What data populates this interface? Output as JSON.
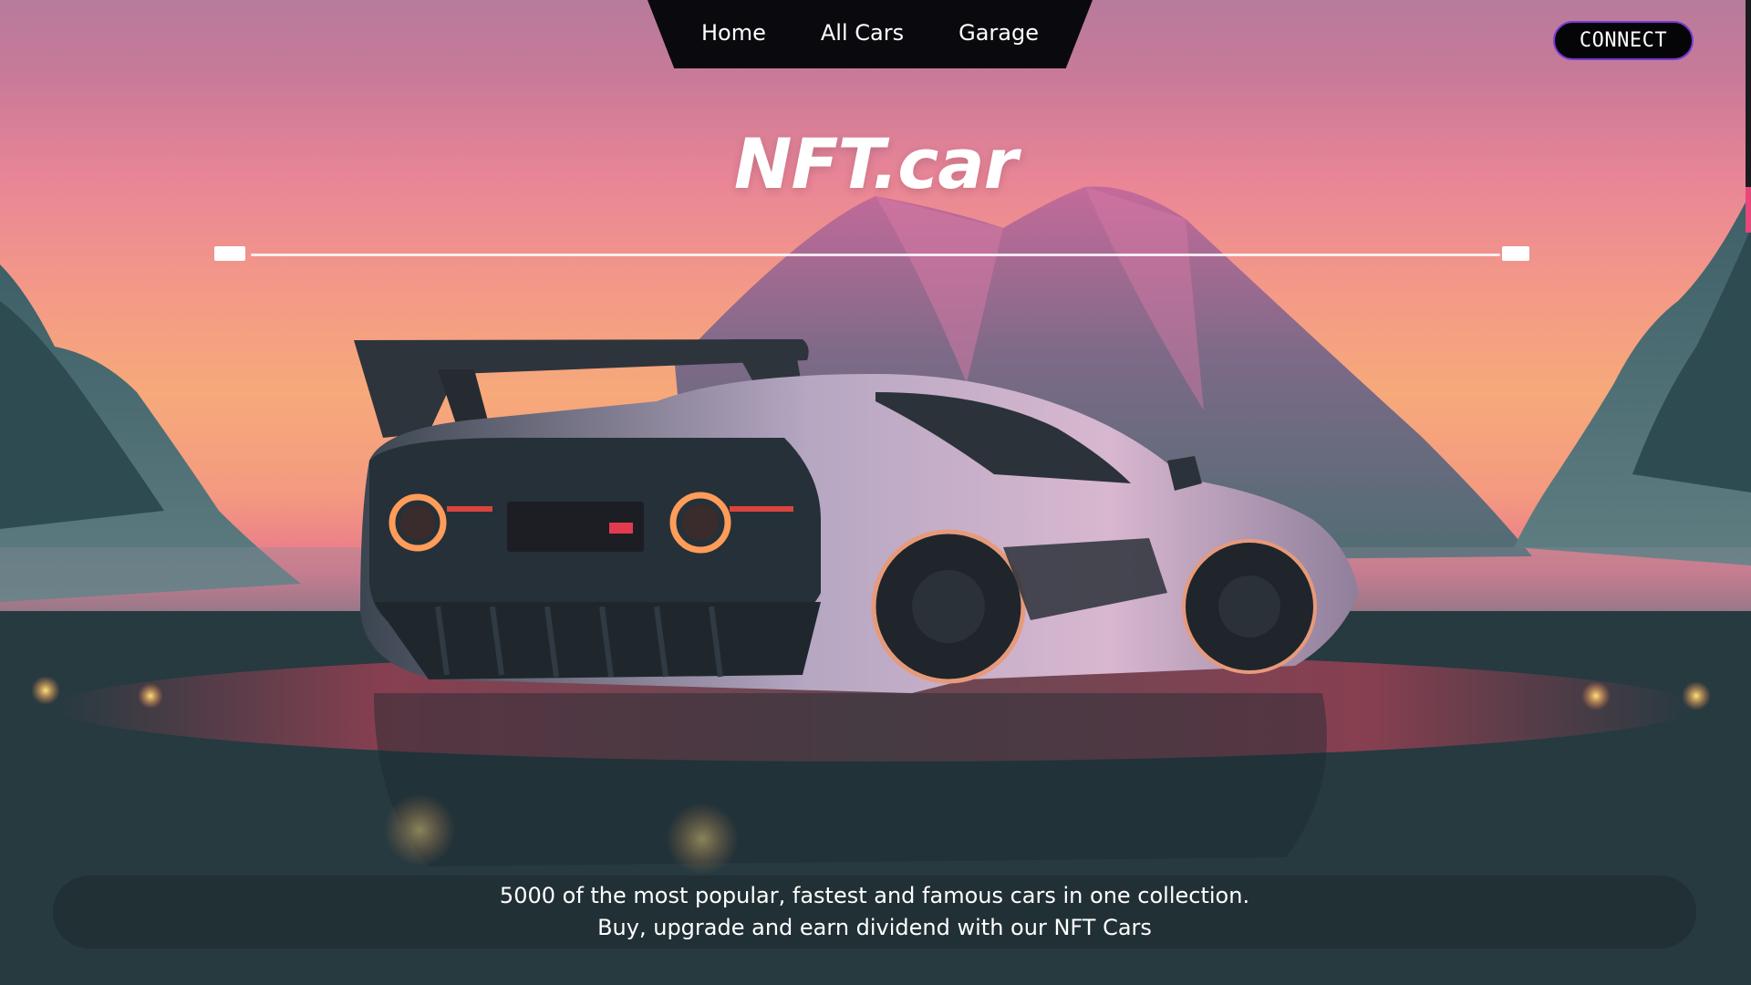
{
  "nav": {
    "items": [
      {
        "label": "Home"
      },
      {
        "label": "All Cars"
      },
      {
        "label": "Garage"
      }
    ],
    "connect_label": "CONNECT"
  },
  "hero": {
    "title": "NFT.car"
  },
  "slider": {
    "left_label": "",
    "right_label": ""
  },
  "banner": {
    "line1": "5000 of the most popular, fastest and famous cars in one collection.",
    "line2": "Buy, upgrade and earn dividend with our NFT Cars"
  },
  "colors": {
    "nav_bg": "#0a0a0e",
    "connect_border": "#7a3ad6",
    "sky_pink": "#e98597",
    "sky_orange": "#f7a97a",
    "ground": "#223338"
  },
  "hero_image": "sports-car-at-sunset-mountains"
}
